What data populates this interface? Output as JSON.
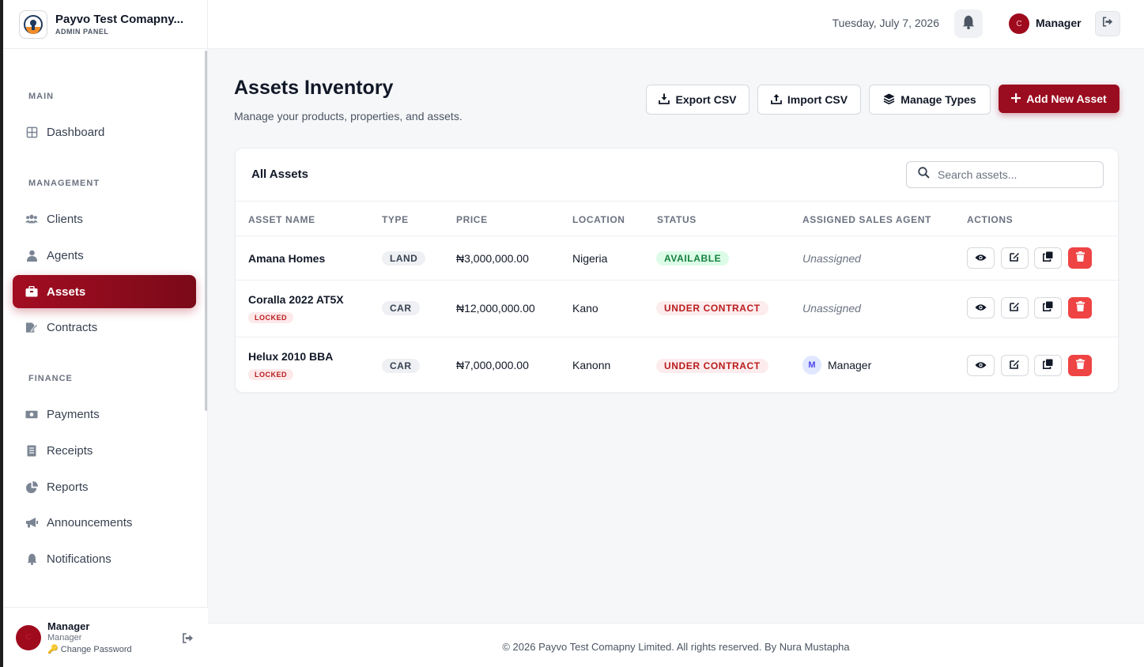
{
  "brand": {
    "title": "Payvo Test Comapny...",
    "subtitle": "ADMIN PANEL"
  },
  "sidebar": {
    "sections": [
      {
        "label": "MAIN"
      },
      {
        "label": "MANAGEMENT"
      },
      {
        "label": "FINANCE"
      }
    ],
    "items": [
      {
        "label": "Dashboard",
        "icon": "dashboard-icon"
      },
      {
        "label": "Clients",
        "icon": "users-icon"
      },
      {
        "label": "Agents",
        "icon": "user-icon"
      },
      {
        "label": "Assets",
        "icon": "box-icon",
        "active": true
      },
      {
        "label": "Contracts",
        "icon": "contract-icon"
      },
      {
        "label": "Payments",
        "icon": "money-icon"
      },
      {
        "label": "Receipts",
        "icon": "receipt-icon"
      },
      {
        "label": "Reports",
        "icon": "pie-chart-icon"
      },
      {
        "label": "Announcements",
        "icon": "megaphone-icon"
      },
      {
        "label": "Notifications",
        "icon": "bell-icon"
      }
    ],
    "user": {
      "initial": "C",
      "name": "Manager",
      "role": "Manager",
      "change_password": "Change Password"
    }
  },
  "header": {
    "date": "Tuesday, July 7, 2026",
    "user_initial": "C",
    "user_name": "Manager"
  },
  "main": {
    "title": "Assets Inventory",
    "subtitle": "Manage your products, properties, and assets.",
    "buttons": {
      "export": "Export CSV",
      "import": "Import CSV",
      "manage_types": "Manage Types",
      "add": "Add New Asset"
    },
    "card_title": "All Assets",
    "search_placeholder": "Search assets...",
    "columns": [
      "ASSET NAME",
      "TYPE",
      "PRICE",
      "LOCATION",
      "STATUS",
      "ASSIGNED SALES AGENT",
      "ACTIONS"
    ],
    "rows": [
      {
        "name": "Amana Homes",
        "locked": "",
        "type": "LAND",
        "price": "₦3,000,000.00",
        "location": "Nigeria",
        "status": "AVAILABLE",
        "agent": "Unassigned",
        "agent_initial": ""
      },
      {
        "name": "Coralla 2022 AT5X",
        "locked": "LOCKED",
        "type": "CAR",
        "price": "₦12,000,000.00",
        "location": "Kano",
        "status": "UNDER CONTRACT",
        "agent": "Unassigned",
        "agent_initial": ""
      },
      {
        "name": "Helux 2010 BBA",
        "locked": "LOCKED",
        "type": "CAR",
        "price": "₦7,000,000.00",
        "location": "Kanonn",
        "status": "UNDER CONTRACT",
        "agent": "Manager",
        "agent_initial": "M"
      }
    ]
  },
  "footer": {
    "text": "© 2026 Payvo Test Comapny Limited. All rights reserved. By Nura Mustapha"
  },
  "colors": {
    "accent": "#9a0c1f",
    "available": "#15803d",
    "contract": "#b91c1c",
    "delete": "#ef4444"
  }
}
